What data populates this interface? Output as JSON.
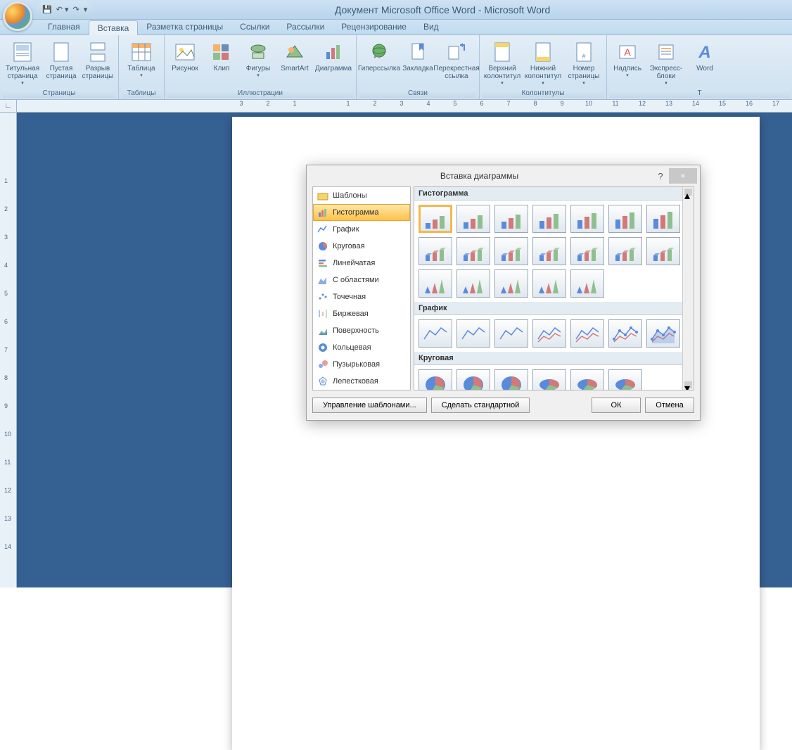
{
  "title": "Документ Microsoft Office Word - Microsoft Word",
  "tabs": [
    "Главная",
    "Вставка",
    "Разметка страницы",
    "Ссылки",
    "Рассылки",
    "Рецензирование",
    "Вид"
  ],
  "active_tab": 1,
  "ribbon_groups": [
    {
      "label": "Страницы",
      "items": [
        "Титульная страница",
        "Пустая страница",
        "Разрыв страницы"
      ]
    },
    {
      "label": "Таблицы",
      "items": [
        "Таблица"
      ]
    },
    {
      "label": "Иллюстрации",
      "items": [
        "Рисунок",
        "Клип",
        "Фигуры",
        "SmartArt",
        "Диаграмма"
      ]
    },
    {
      "label": "Связи",
      "items": [
        "Гиперссылка",
        "Закладка",
        "Перекрестная ссылка"
      ]
    },
    {
      "label": "Колонтитулы",
      "items": [
        "Верхний колонтитул",
        "Нижний колонтитул",
        "Номер страницы"
      ]
    },
    {
      "label": "",
      "items": [
        "Надпись",
        "Экспресс-блоки",
        "Word"
      ]
    }
  ],
  "hruler_labels": [
    "3",
    "2",
    "1",
    "",
    "1",
    "2",
    "3",
    "4",
    "5",
    "6",
    "7",
    "8",
    "9",
    "10",
    "11",
    "12",
    "13",
    "14",
    "15",
    "16",
    "17"
  ],
  "vruler_labels": [
    "",
    "",
    "1",
    "2",
    "3",
    "4",
    "5",
    "6",
    "7",
    "8",
    "9",
    "10",
    "11",
    "12",
    "13",
    "14"
  ],
  "dialog": {
    "title": "Вставка диаграммы",
    "help": "?",
    "close": "×",
    "categories": [
      "Шаблоны",
      "Гистограмма",
      "График",
      "Круговая",
      "Линейчатая",
      "С областями",
      "Точечная",
      "Биржевая",
      "Поверхность",
      "Кольцевая",
      "Пузырьковая",
      "Лепестковая"
    ],
    "selected_category": 1,
    "sections": [
      {
        "header": "Гистограмма",
        "count": 19
      },
      {
        "header": "График",
        "count": 7
      },
      {
        "header": "Круговая",
        "count": 6
      }
    ],
    "buttons": {
      "manage": "Управление шаблонами...",
      "default": "Сделать стандартной",
      "ok": "ОК",
      "cancel": "Отмена"
    }
  }
}
